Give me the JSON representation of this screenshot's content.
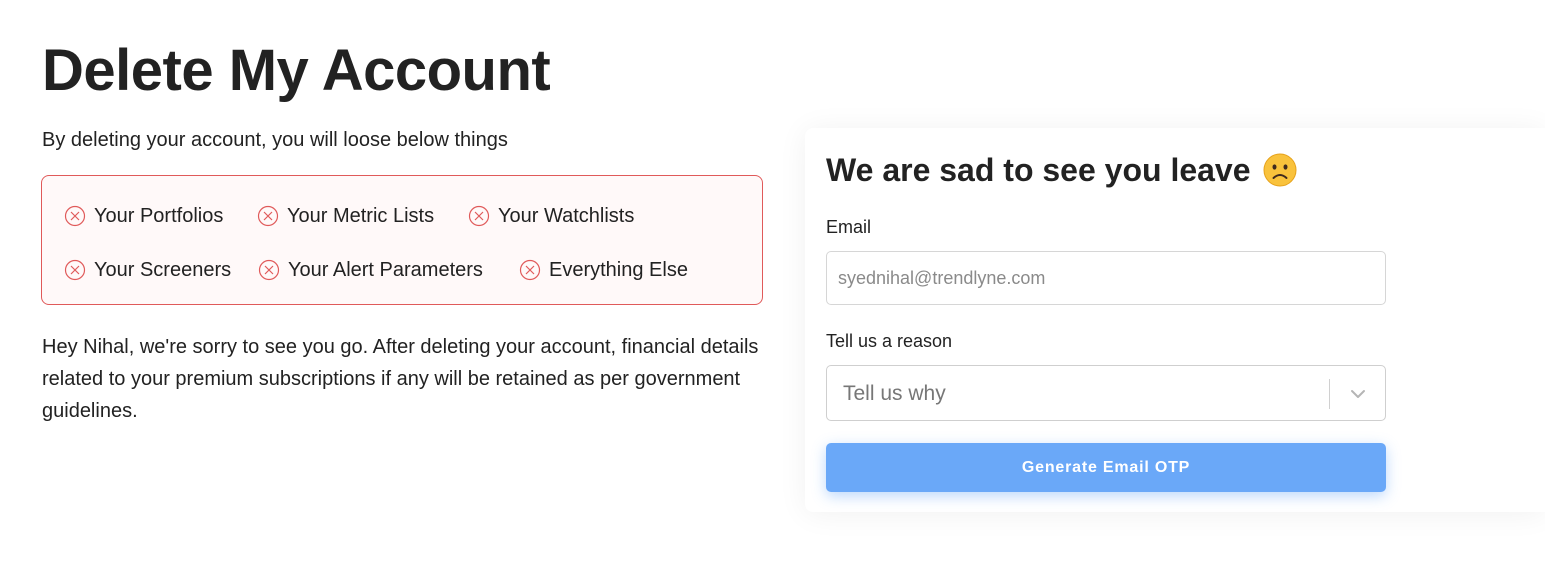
{
  "page": {
    "title": "Delete My Account",
    "intro": "By deleting your account, you will loose below things",
    "losses": [
      "Your Portfolios",
      "Your Metric Lists",
      "Your Watchlists",
      "Your Screeners",
      "Your Alert Parameters",
      "Everything Else"
    ],
    "notice": "Hey Nihal, we're sorry to see you go. After deleting your account, financial details related to your premium subscriptions if any will be retained as per government guidelines."
  },
  "form": {
    "title": "We are sad to see you leave",
    "title_icon": "sad-face-emoji",
    "email_label": "Email",
    "email_placeholder": "syednihal@trendlyne.com",
    "reason_label": "Tell us a reason",
    "reason_value": "Tell us why",
    "submit_label": "Generate Email OTP"
  },
  "colors": {
    "loss_border": "#e05a5a",
    "loss_icon": "#e05a5a",
    "button": "#6aa8f8"
  }
}
